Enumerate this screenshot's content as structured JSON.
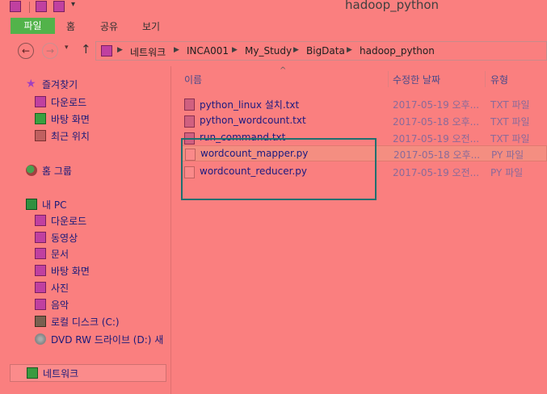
{
  "window": {
    "title": "hadoop_python"
  },
  "ribbon": {
    "file_tab": "파일",
    "tabs": [
      "홈",
      "공유",
      "보기"
    ]
  },
  "address": {
    "breadcrumbs": [
      "네트워크",
      "INCA001",
      "My_Study",
      "BigData",
      "hadoop_python"
    ]
  },
  "nav_pane": {
    "favorites": {
      "label": "즐겨찾기",
      "items": [
        "다운로드",
        "바탕 화면",
        "최근 위치"
      ]
    },
    "homegroup": "홈 그룹",
    "this_pc": {
      "label": "내 PC",
      "items": [
        "다운로드",
        "동영상",
        "문서",
        "바탕 화면",
        "사진",
        "음악",
        "로컬 디스크 (C:)",
        "DVD RW 드라이브 (D:) 새"
      ]
    },
    "network": "네트워크"
  },
  "columns": {
    "name": "이름",
    "date": "수정한 날짜",
    "type": "유형"
  },
  "files": [
    {
      "name": "python_linux 설치.txt",
      "date": "2017-05-19 오후...",
      "type": "TXT 파일",
      "kind": "txt"
    },
    {
      "name": "python_wordcount.txt",
      "date": "2017-05-18 오후...",
      "type": "TXT 파일",
      "kind": "txt"
    },
    {
      "name": "run_command.txt",
      "date": "2017-05-19 오전...",
      "type": "TXT 파일",
      "kind": "txt"
    },
    {
      "name": "wordcount_mapper.py",
      "date": "2017-05-18 오후...",
      "type": "PY 파일",
      "kind": "py"
    },
    {
      "name": "wordcount_reducer.py",
      "date": "2017-05-19 오전...",
      "type": "PY 파일",
      "kind": "py"
    }
  ]
}
